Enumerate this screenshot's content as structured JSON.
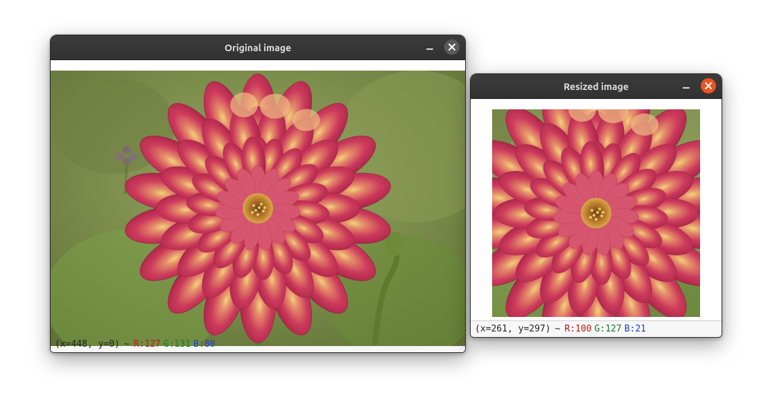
{
  "windows": {
    "original": {
      "title": "Original image",
      "status": {
        "coord": "(x=448, y=0)",
        "sep": "~",
        "r": "R:127",
        "g": "G:131",
        "b": "B:80"
      }
    },
    "resized": {
      "title": "Resized image",
      "status": {
        "coord": "(x=261, y=297)",
        "sep": "~",
        "r": "R:100",
        "g": "G:127",
        "b": "B:21"
      }
    }
  }
}
